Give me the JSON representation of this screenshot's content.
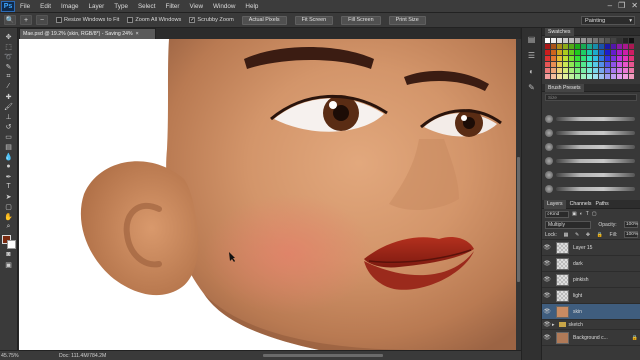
{
  "app": {
    "logo": "Ps"
  },
  "menu": [
    "File",
    "Edit",
    "Image",
    "Layer",
    "Type",
    "Select",
    "Filter",
    "View",
    "Window",
    "Help"
  ],
  "window_controls": [
    "–",
    "❐",
    "✕"
  ],
  "options_bar": {
    "checkbox_resize": "Resize Windows to Fit",
    "checkbox_zoom_all": "Zoom All Windows",
    "checkbox_scrubby": "Scrubby Zoom",
    "btn_actual": "Actual Pixels",
    "btn_fit": "Fit Screen",
    "btn_fill": "Fill Screen",
    "btn_print": "Print Size",
    "workspace": "Painting"
  },
  "document": {
    "tab_title": "Mae.psd @ 19.2% (skin, RGB/8*) - Saving 24%",
    "zoom": "45.75%",
    "doc_info": "Doc: 111.4M/784.2M"
  },
  "swatches_panel": {
    "title": "Swatches"
  },
  "brush_panel": {
    "title": "Brush Presets",
    "search_placeholder": "Size"
  },
  "layers_panel": {
    "tabs": [
      "Layers",
      "Channels",
      "Paths"
    ],
    "kind_label": "Kind",
    "blend_mode": "Multiply",
    "opacity_label": "Opacity:",
    "opacity_value": "100%",
    "lock_label": "Lock:",
    "fill_label": "Fill:",
    "fill_value": "100%",
    "layers": [
      {
        "name": "Layer 15"
      },
      {
        "name": "dark"
      },
      {
        "name": "pinkish"
      },
      {
        "name": "light"
      },
      {
        "name": "skin"
      }
    ],
    "group_sketch": "sketch",
    "background": "Background c..."
  },
  "colors": {
    "accent_selected": "#3f5d7e",
    "foreground": "#7a2a10",
    "background": "#ffffff"
  }
}
